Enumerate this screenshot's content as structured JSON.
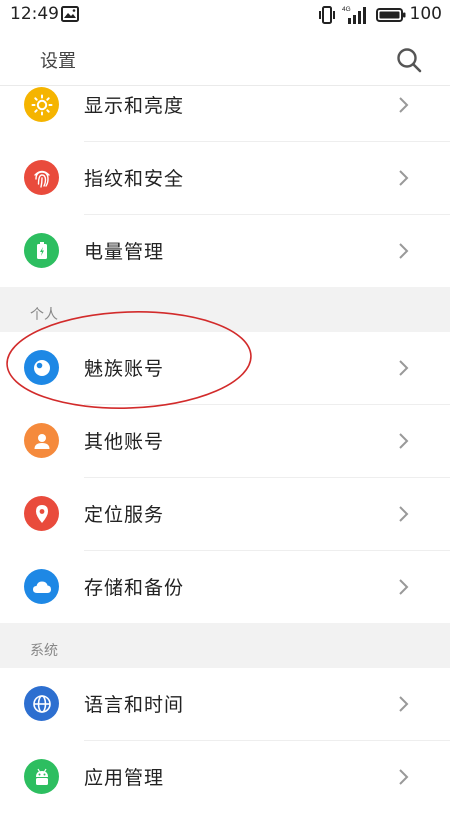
{
  "status": {
    "time": "12:49",
    "network": "4G",
    "battery": "100"
  },
  "header": {
    "title": "设置"
  },
  "items": [
    {
      "label": "显示和亮度",
      "icon": "sun-icon",
      "color": "#F5B400"
    },
    {
      "label": "指纹和安全",
      "icon": "fingerprint-icon",
      "color": "#E94B3C"
    },
    {
      "label": "电量管理",
      "icon": "battery-icon",
      "color": "#2DBE60"
    },
    {
      "label": "魅族账号",
      "icon": "meizu-account-icon",
      "color": "#1E88E5"
    },
    {
      "label": "其他账号",
      "icon": "person-icon",
      "color": "#F58A3C"
    },
    {
      "label": "定位服务",
      "icon": "location-pin-icon",
      "color": "#E94B3C"
    },
    {
      "label": "存储和备份",
      "icon": "cloud-icon",
      "color": "#1E88E5"
    },
    {
      "label": "语言和时间",
      "icon": "globe-icon",
      "color": "#2D6FD0"
    },
    {
      "label": "应用管理",
      "icon": "android-icon",
      "color": "#2DBE60"
    }
  ],
  "sections": {
    "personal": "个人",
    "system": "系统"
  },
  "colors": {
    "annotation": "#D22B2B"
  }
}
